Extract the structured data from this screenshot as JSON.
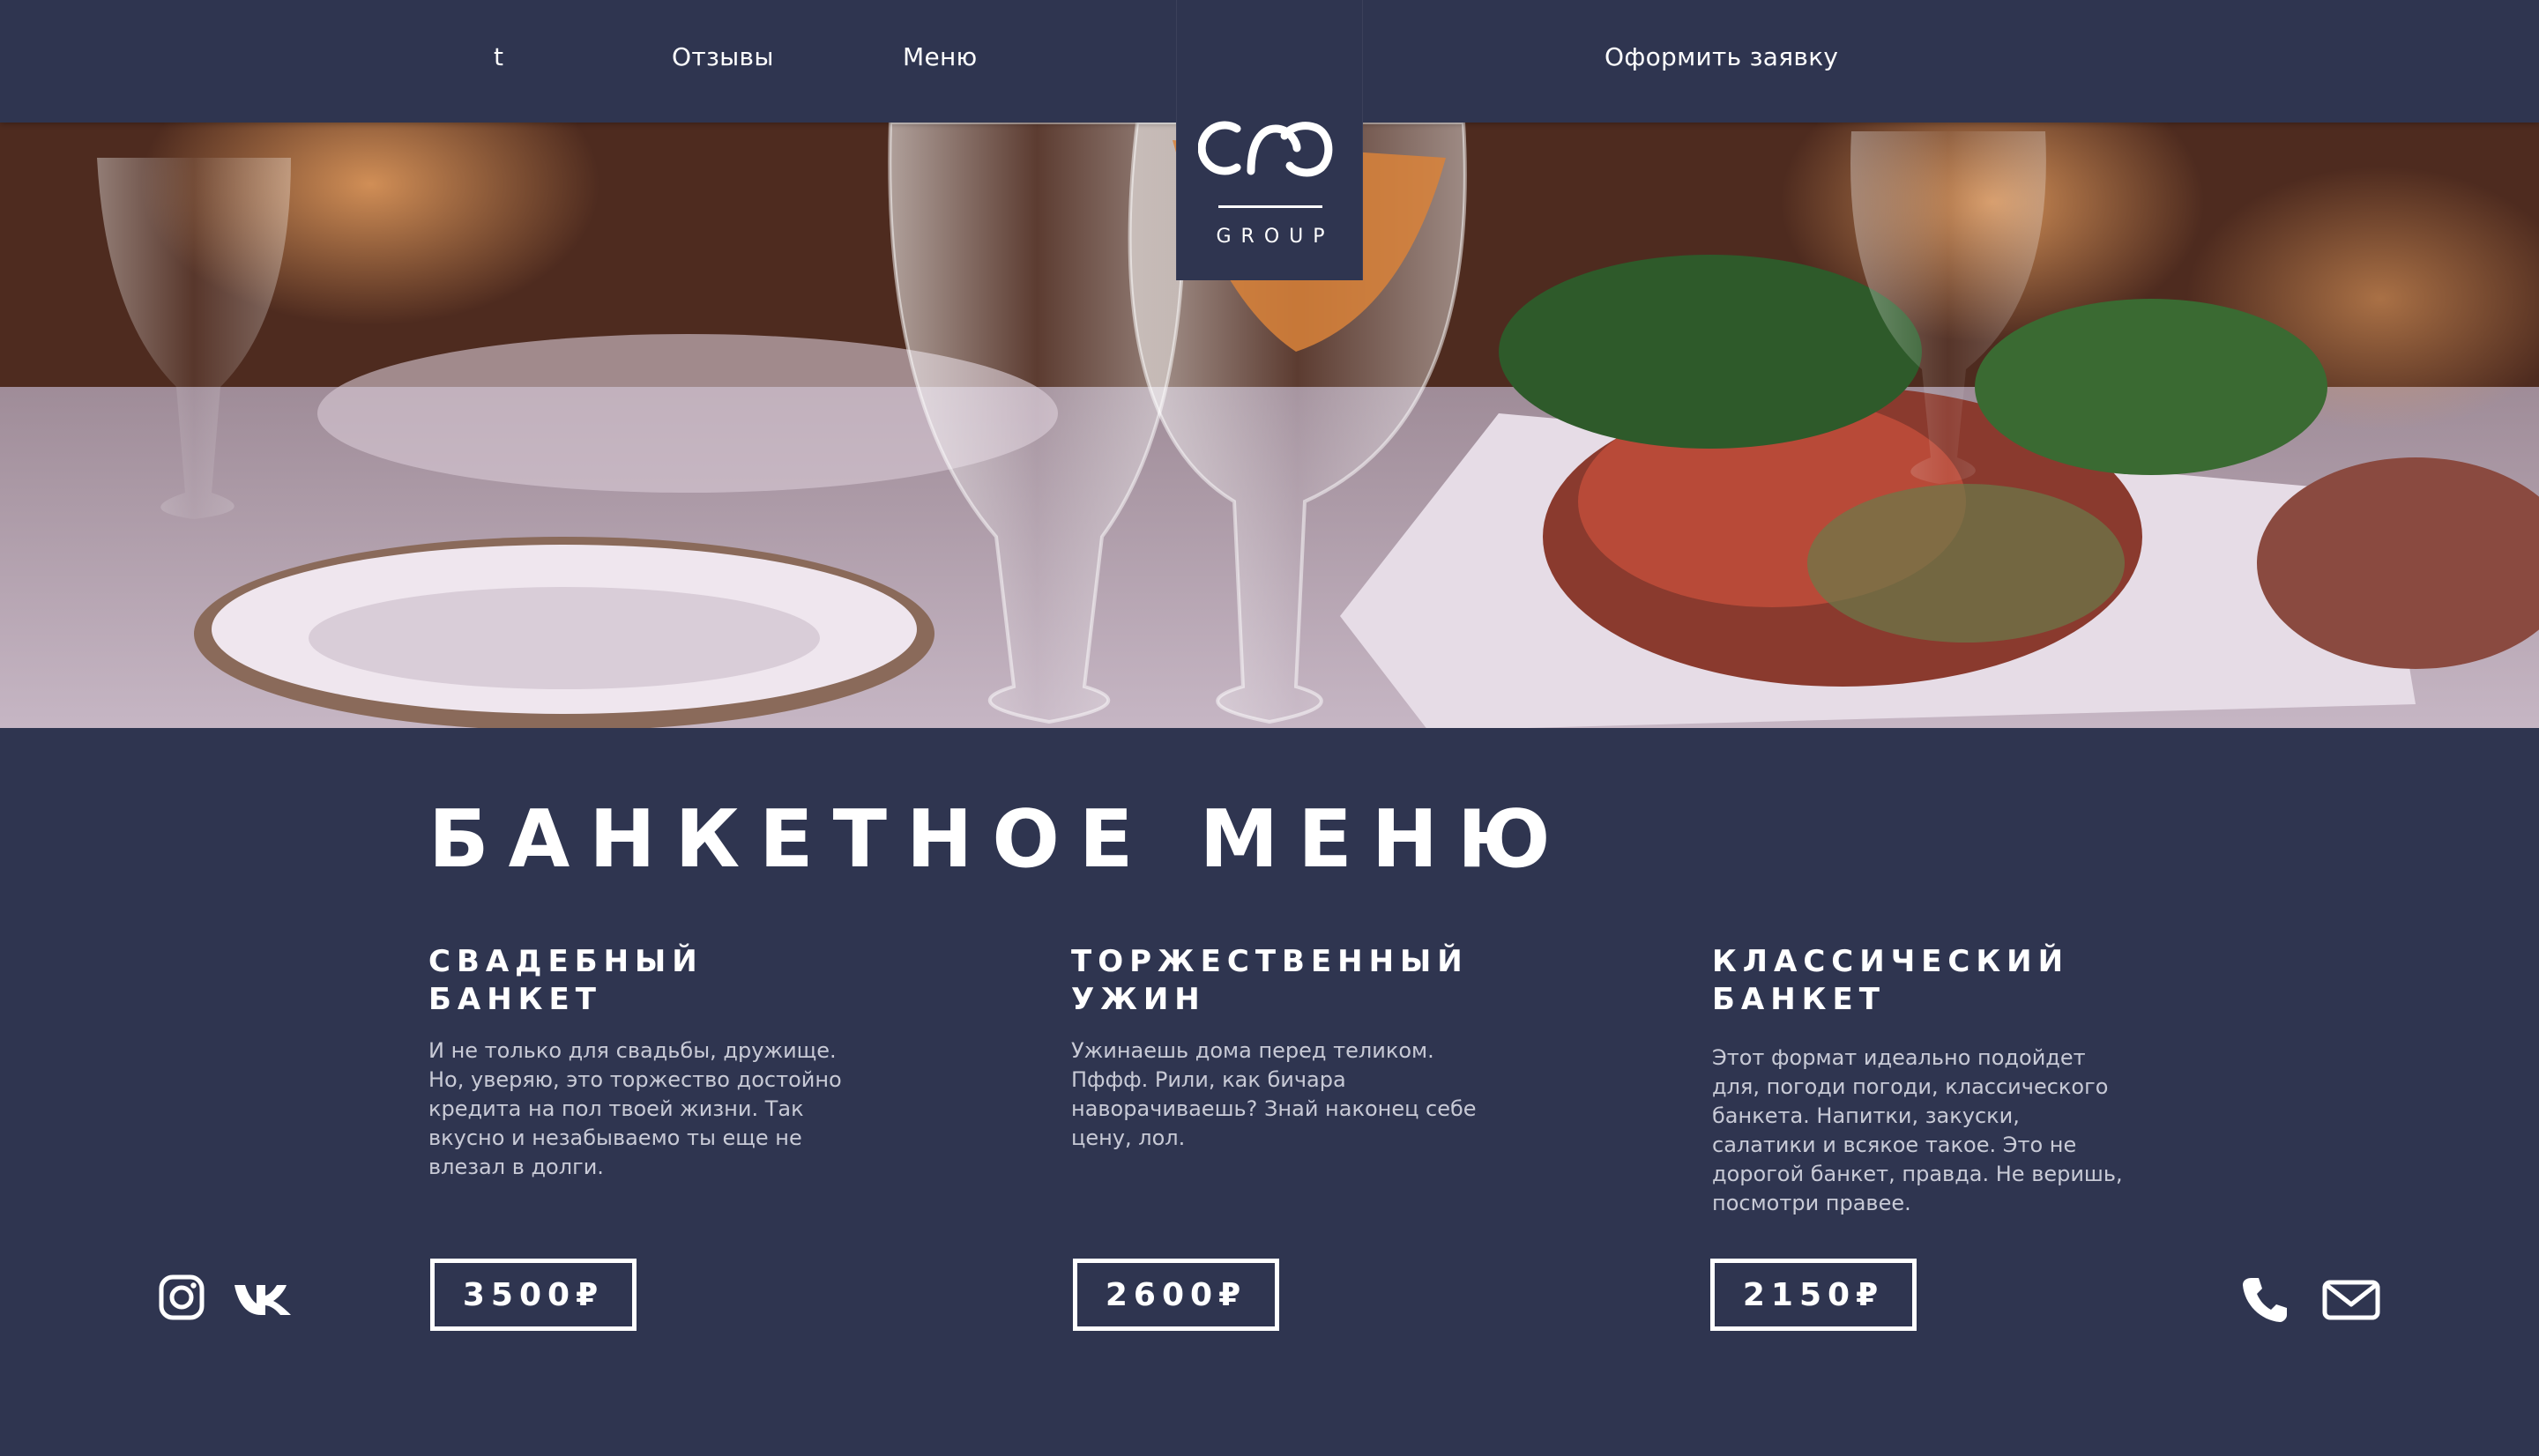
{
  "nav": {
    "items": [
      "t",
      "Отзывы",
      "Меню"
    ],
    "cta": "Оформить заявку"
  },
  "logo": {
    "text": "GROUP"
  },
  "section": {
    "title": "БАНКЕТНОЕ МЕНЮ"
  },
  "cards": [
    {
      "title_lines": [
        "СВАДЕБНЫЙ",
        "БАНКЕТ"
      ],
      "text": "И не только для свадьбы, дружище. Но, уверяю, это торжество достойно кредита на пол твоей жизни. Так вкусно и незабываемо ты еще не влезал в долги.",
      "price": "3500₽"
    },
    {
      "title_lines": [
        "ТОРЖЕСТВЕННЫЙ",
        "УЖИН"
      ],
      "text": "Ужинаешь дома перед теликом. Пффф. Рили, как бичара наворачиваешь? Знай наконец себе цену, лол.",
      "price": "2600₽"
    },
    {
      "title_lines": [
        "КЛАССИЧЕСКИЙ",
        "БАНКЕТ"
      ],
      "text": "Этот формат идеально подойдет для, погоди погоди, классического банкета. Напитки, закуски, салатики и всякое такое. Это не дорогой банкет, правда. Не веришь, посмотри правее.",
      "price": "2150₽"
    }
  ],
  "icons": {
    "social": [
      "instagram-icon",
      "vk-icon"
    ],
    "contact": [
      "phone-icon",
      "mail-icon"
    ]
  },
  "colors": {
    "background": "#2f3550",
    "text": "#ffffff",
    "muted_text": "#c8cad6"
  }
}
